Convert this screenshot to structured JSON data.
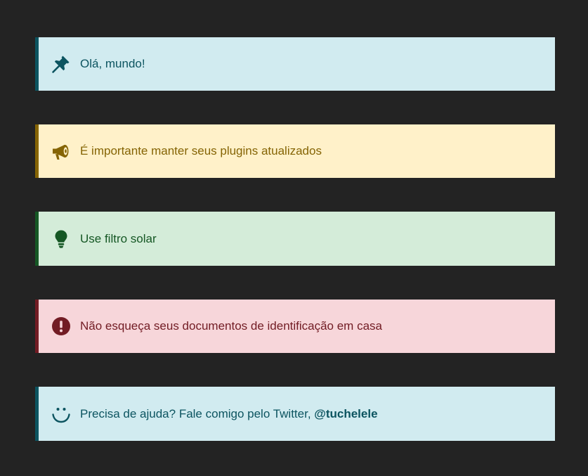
{
  "notices": [
    {
      "type": "info",
      "icon": "pushpin-icon",
      "text": "Olá, mundo!"
    },
    {
      "type": "warning",
      "icon": "megaphone-icon",
      "text": "É importante manter seus plugins atualizados"
    },
    {
      "type": "success",
      "icon": "lightbulb-icon",
      "text": "Use filtro solar"
    },
    {
      "type": "danger",
      "icon": "exclamation-circle-icon",
      "text": "Não esqueça seus documentos de identificação em casa"
    },
    {
      "type": "info",
      "icon": "smile-icon",
      "text": "Precisa de ajuda? Fale comigo pelo Twitter, ",
      "link_text": "@tuchelele"
    }
  ],
  "colors": {
    "page_background": "#232323",
    "info_background": "#d1ebf0",
    "info_foreground": "#0c5460",
    "warning_background": "#fff1c9",
    "warning_foreground": "#856404",
    "success_background": "#d4ecd9",
    "success_foreground": "#155724",
    "danger_background": "#f7d6da",
    "danger_foreground": "#721c24"
  }
}
